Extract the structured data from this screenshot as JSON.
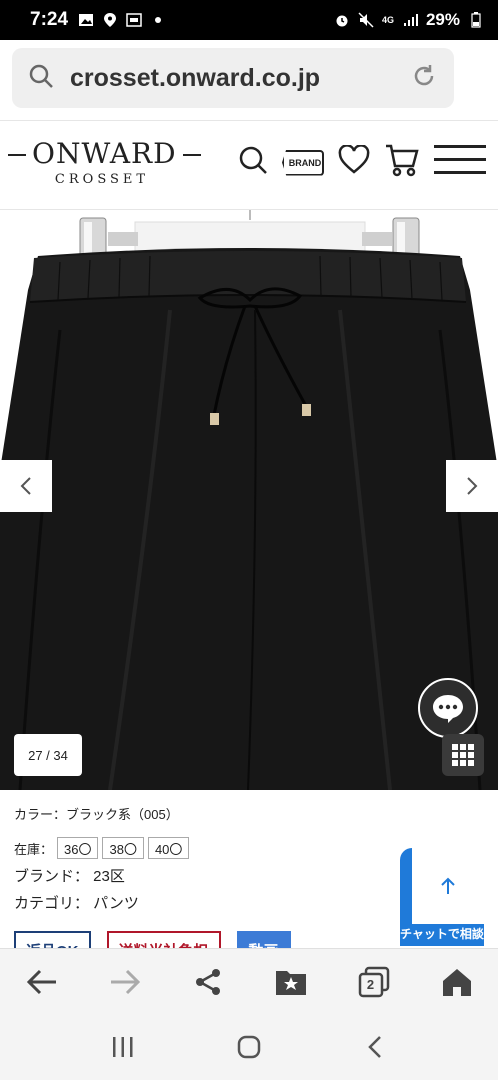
{
  "status_bar": {
    "time": "7:24",
    "network": "4G",
    "battery": "29%"
  },
  "browser": {
    "url": "crosset.onward.co.jp",
    "tab_count": "2"
  },
  "site_header": {
    "logo_main": "ONWARD",
    "logo_sub": "CROSSET",
    "brand_button_label": "BRAND"
  },
  "gallery": {
    "counter": "27 / 34",
    "prev_icon": "chevron-left",
    "next_icon": "chevron-right"
  },
  "product": {
    "color_line": "カラー：ブラック系（005）",
    "stock_label": "在庫：",
    "sizes": [
      {
        "label": "36〇"
      },
      {
        "label": "38〇"
      },
      {
        "label": "40〇"
      }
    ],
    "brand_line": "ブランド： 23区",
    "category_line": "カテゴリ： パンツ",
    "badges": {
      "return": "返品OK",
      "shipping": "送料当社負担",
      "video": "動画"
    },
    "chat_consult_label": "チャットで相談",
    "scroll_top_icon": "arrow-up"
  },
  "colors": {
    "badge_return": "#1d3f77",
    "badge_shipping": "#b0172a",
    "badge_video": "#3c7bd6",
    "chat_blue": "#1f7ad9"
  }
}
